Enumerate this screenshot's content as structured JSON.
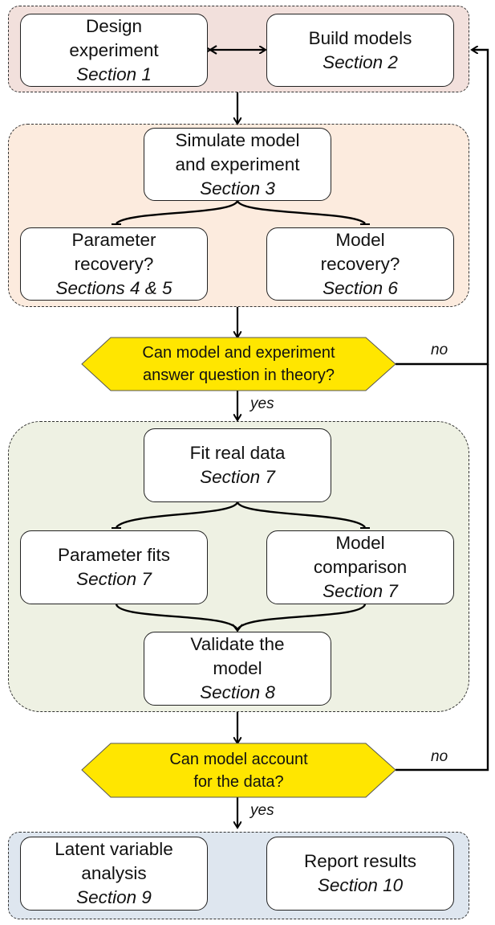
{
  "groups": [
    {
      "name": "design-build-group",
      "color": "#f2e0dc"
    },
    {
      "name": "simulation-group",
      "color": "#fcebde"
    },
    {
      "name": "fitting-group",
      "color": "#eef1e3"
    },
    {
      "name": "analysis-group",
      "color": "#dee6ef"
    }
  ],
  "nodes": {
    "design": {
      "lines": [
        "Design",
        "experiment"
      ],
      "section": "Section 1"
    },
    "build": {
      "lines": [
        "Build models"
      ],
      "section": "Section 2"
    },
    "simulate": {
      "lines": [
        "Simulate model",
        "and experiment"
      ],
      "section": "Section 3"
    },
    "param_recovery": {
      "lines": [
        "Parameter",
        "recovery?"
      ],
      "section": "Sections 4 & 5"
    },
    "model_recovery": {
      "lines": [
        "Model",
        "recovery?"
      ],
      "section": "Section 6"
    },
    "fit": {
      "lines": [
        "Fit real data"
      ],
      "section": "Section 7"
    },
    "param_fits": {
      "lines": [
        "Parameter fits"
      ],
      "section": "Section 7"
    },
    "model_comparison": {
      "lines": [
        "Model",
        "comparison"
      ],
      "section": "Section 7"
    },
    "validate": {
      "lines": [
        "Validate the",
        "model"
      ],
      "section": "Section 8"
    },
    "latent": {
      "lines": [
        "Latent variable",
        "analysis"
      ],
      "section": "Section 9"
    },
    "report": {
      "lines": [
        "Report results"
      ],
      "section": "Section 10"
    }
  },
  "decisions": {
    "theory": {
      "lines": [
        "Can model and experiment",
        "answer question in theory?"
      ],
      "color": "#ffe600"
    },
    "account": {
      "lines": [
        "Can model account",
        "for the data?"
      ],
      "color": "#ffe600"
    }
  },
  "edge_labels": {
    "theory_no": "no",
    "theory_yes": "yes",
    "account_no": "no",
    "account_yes": "yes"
  }
}
